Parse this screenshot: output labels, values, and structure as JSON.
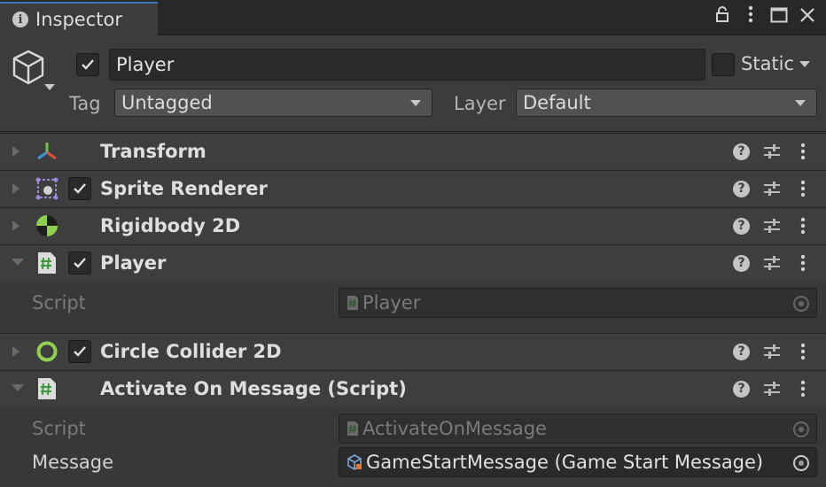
{
  "tab": {
    "title": "Inspector",
    "icon": "info-icon",
    "actions": [
      "lock-icon",
      "more-vert-icon",
      "maximize-icon",
      "close-icon"
    ]
  },
  "header": {
    "name": "Player",
    "active": true,
    "static_label": "Static",
    "static": false,
    "tag_label": "Tag",
    "tag_value": "Untagged",
    "layer_label": "Layer",
    "layer_value": "Default"
  },
  "components": [
    {
      "name": "Transform",
      "icon": "transform-icon",
      "expanded": false,
      "has_toggle": false
    },
    {
      "name": "Sprite Renderer",
      "icon": "sprite-renderer-icon",
      "expanded": false,
      "has_toggle": true,
      "enabled": true
    },
    {
      "name": "Rigidbody 2D",
      "icon": "rigidbody2d-icon",
      "expanded": false,
      "has_toggle": false
    },
    {
      "name": "Player",
      "icon": "script-icon",
      "expanded": true,
      "has_toggle": true,
      "enabled": true,
      "properties": [
        {
          "label": "Script",
          "value": "Player",
          "disabled": true
        }
      ]
    },
    {
      "name": "Circle Collider 2D",
      "icon": "circle-collider-icon",
      "expanded": false,
      "has_toggle": true,
      "enabled": true
    },
    {
      "name": "Activate On Message (Script)",
      "icon": "script-icon",
      "expanded": true,
      "has_toggle": false,
      "properties": [
        {
          "label": "Script",
          "value": "ActivateOnMessage",
          "disabled": true
        },
        {
          "label": "Message",
          "value": "GameStartMessage (Game Start Message)",
          "disabled": false
        }
      ]
    }
  ],
  "colors": {
    "accent": "#3a79bb",
    "background": "#383838",
    "header": "#3e3e3e"
  }
}
